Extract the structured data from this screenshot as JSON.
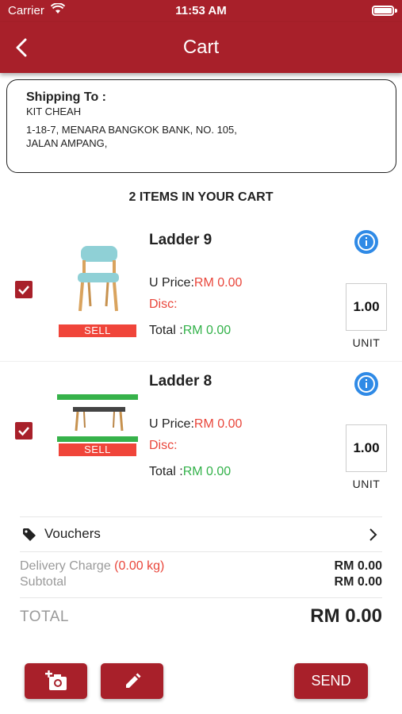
{
  "status_bar": {
    "carrier": "Carrier",
    "time": "11:53 AM"
  },
  "nav": {
    "title": "Cart",
    "back_icon": "chevron-left-icon"
  },
  "shipping": {
    "heading": "Shipping To :",
    "name": "KIT CHEAH",
    "address_line1": "1-18-7, MENARA BANGKOK BANK,  NO. 105,",
    "address_line2": "JALAN AMPANG,"
  },
  "cart": {
    "items_count_label": "2 ITEMS IN YOUR CART",
    "items": [
      {
        "name": "Ladder 9",
        "checked": true,
        "badge": "SELL",
        "uprice_label": "U Price:",
        "uprice_value": "RM 0.00",
        "disc_label": "Disc:",
        "total_label": "Total :",
        "total_value": "RM 0.00",
        "quantity": "1.00",
        "unit": "UNIT",
        "image": "chair-image"
      },
      {
        "name": "Ladder 8",
        "checked": true,
        "badge": "SELL",
        "uprice_label": "U Price:",
        "uprice_value": "RM 0.00",
        "disc_label": "Disc:",
        "total_label": "Total :",
        "total_value": "RM 0.00",
        "quantity": "1.00",
        "unit": "UNIT",
        "image": "table-image"
      }
    ]
  },
  "vouchers": {
    "label": "Vouchers"
  },
  "charges": {
    "delivery_label": "Delivery Charge",
    "delivery_weight": "(0.00 kg)",
    "delivery_value": "RM 0.00",
    "subtotal_label": "Subtotal",
    "subtotal_value": "RM 0.00",
    "total_label": "TOTAL",
    "total_value": "RM 0.00"
  },
  "actions": {
    "send_label": "SEND"
  },
  "colors": {
    "brand": "#a8202a",
    "price_red": "#e9463b",
    "total_green": "#33b24a",
    "info_blue": "#2f8ae6"
  }
}
